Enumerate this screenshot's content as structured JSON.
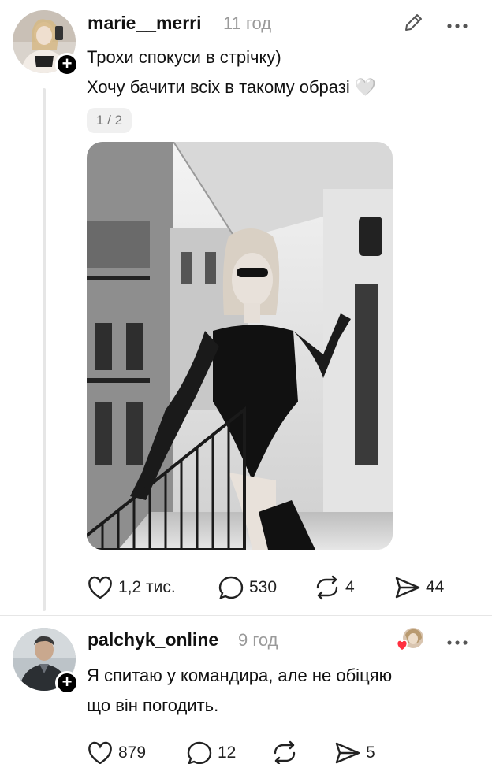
{
  "post": {
    "username": "marie__merri",
    "time": "11 год",
    "lines": [
      "Трохи спокуси в стрічку)",
      "Хочу бачити всіх в такому образі 🤍"
    ],
    "media_counter": "1 / 2",
    "photo_alt": "photo",
    "actions": {
      "likes": "1,2 тис.",
      "comments": "530",
      "reposts": "4",
      "shares": "44"
    },
    "icons": [
      "heart-icon",
      "comment-icon",
      "repost-icon",
      "share-icon",
      "edit-icon",
      "more-icon"
    ]
  },
  "reply": {
    "username": "palchyk_online",
    "time": "9 год",
    "lines": [
      "Я спитаю у командира, але не обіцяю",
      "що він погодить."
    ],
    "actions": {
      "likes": "879",
      "comments": "12",
      "reposts": "",
      "shares": "5"
    },
    "icons": [
      "heart-icon",
      "comment-icon",
      "repost-icon",
      "share-icon",
      "liked-by-author-icon",
      "more-icon"
    ]
  },
  "colors": {
    "text": "#111111",
    "muted": "#9a9a9a",
    "divider": "#e6e6e6"
  }
}
